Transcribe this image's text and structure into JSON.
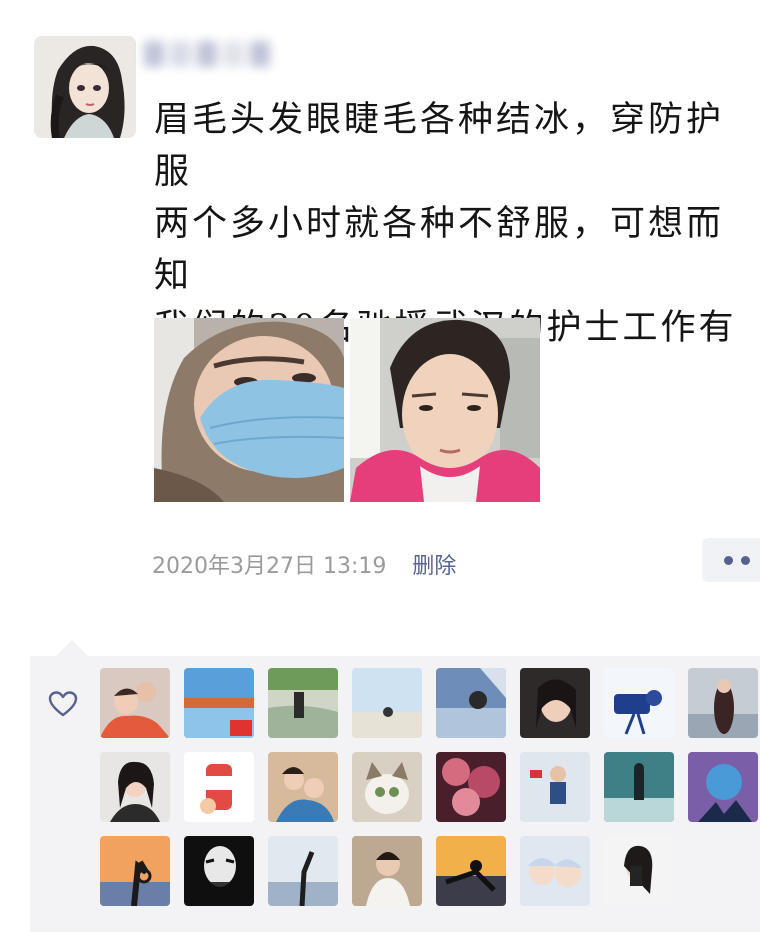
{
  "post": {
    "text": "眉毛头发眼睫毛各种结冰，穿防护服\n两个多小时就各种不舒服，可想而知\n我们的30名驰援武汉的护士工作有多\n辛苦！",
    "timestamp": "2020年3月27日  13:19",
    "delete_label": "删除"
  },
  "author": {
    "avatar_icon": "anime-girl-avatar",
    "nickname_blurred": true
  },
  "photos": [
    {
      "name": "nurse-masked-photo"
    },
    {
      "name": "nurse-portrait-photo"
    }
  ],
  "likes": {
    "icon": "heart-icon",
    "count": 24
  },
  "colors": {
    "link": "#56638e",
    "meta_text": "#9a9a9a",
    "like_panel": "#f3f3f5"
  }
}
